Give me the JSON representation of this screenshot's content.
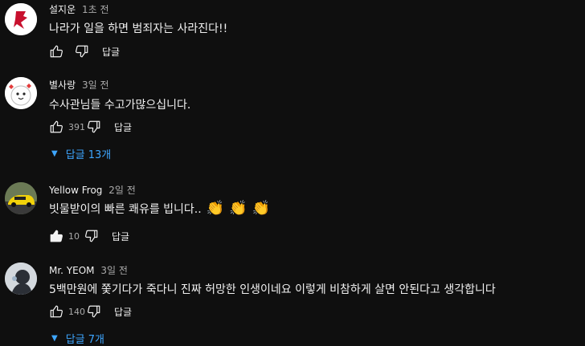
{
  "comments": [
    {
      "author": "설지운",
      "time": "1초 전",
      "text": "나라가 일을 하면 범죄자는 사라진다!!",
      "likes": "",
      "reply_label": "답글"
    },
    {
      "author": "별사랑",
      "time": "3일 전",
      "text": "수사관님들 수고가많으십니다.",
      "likes": "391",
      "reply_label": "답글",
      "replies_label": "답글 13개"
    },
    {
      "author": "Yellow Frog",
      "time": "2일 전",
      "text": "빗물받이의 빠른 쾌유를 빕니다..",
      "emojis": [
        "👏",
        "👏",
        "👏"
      ],
      "likes": "10",
      "reply_label": "답글"
    },
    {
      "author": "Mr. YEOM",
      "time": "3일 전",
      "text": "5백만원에 쫓기다가 죽다니 진짜 허망한 인생이네요 이렇게 비참하게 살면 안된다고 생각합니다",
      "likes": "140",
      "reply_label": "답글",
      "replies_label": "답글 7개"
    }
  ],
  "icons": {
    "like": "thumbs-up-icon",
    "dislike": "thumbs-down-icon",
    "replies_toggle": "triangle-down-icon"
  },
  "colors": {
    "background": "#0f0f0f",
    "text": "#f1f1f1",
    "muted": "#aaaaaa",
    "link": "#3ea6ff"
  }
}
